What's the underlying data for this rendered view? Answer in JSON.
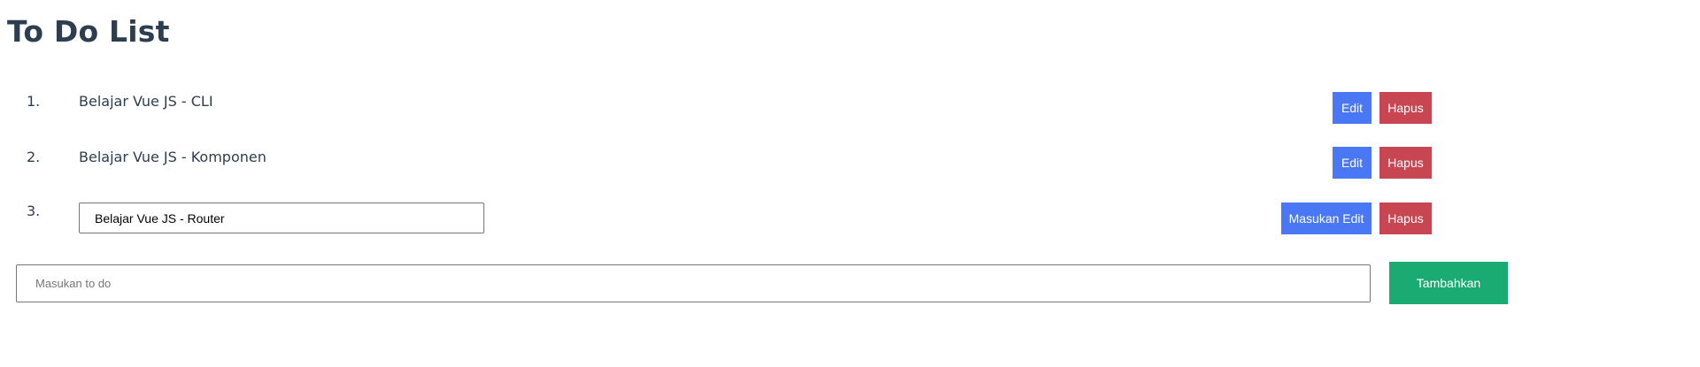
{
  "page": {
    "title": "To Do List"
  },
  "todos": [
    {
      "number": "1.",
      "text": "Belajar Vue JS - CLI",
      "editing": false,
      "edit_label": "Edit",
      "delete_label": "Hapus"
    },
    {
      "number": "2.",
      "text": "Belajar Vue JS - Komponen",
      "editing": false,
      "edit_label": "Edit",
      "delete_label": "Hapus"
    },
    {
      "number": "3.",
      "text": "Belajar Vue JS - Router",
      "editing": true,
      "edit_label": "Masukan Edit",
      "delete_label": "Hapus"
    }
  ],
  "add_form": {
    "placeholder": "Masukan to do",
    "value": "",
    "button_label": "Tambahkan"
  },
  "colors": {
    "edit_button": "#4a78f5",
    "delete_button": "#c74652",
    "add_button": "#1aab73",
    "text": "#2c3e50"
  }
}
